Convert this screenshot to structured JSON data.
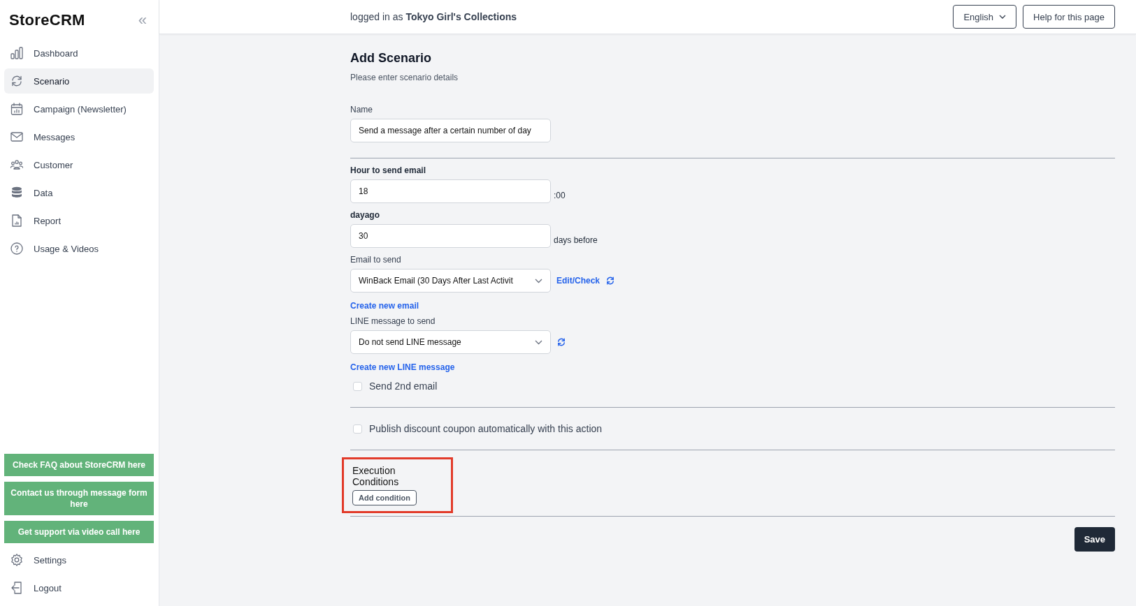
{
  "sidebar": {
    "logo": "StoreCRM",
    "collapse": "«",
    "items": [
      {
        "label": "Dashboard",
        "selected": false
      },
      {
        "label": "Scenario",
        "selected": true
      },
      {
        "label": "Campaign (Newsletter)",
        "selected": false
      },
      {
        "label": "Messages",
        "selected": false
      },
      {
        "label": "Customer",
        "selected": false
      },
      {
        "label": "Data",
        "selected": false
      },
      {
        "label": "Report",
        "selected": false
      },
      {
        "label": "Usage & Videos",
        "selected": false
      }
    ],
    "support_buttons": [
      "Check FAQ about StoreCRM here",
      "Contact us through message form here",
      "Get support via video call here"
    ],
    "bottom_items": [
      {
        "label": "Settings",
        "selected": false
      },
      {
        "label": "Logout",
        "selected": false
      }
    ]
  },
  "header": {
    "login_text": "logged in as **Tokyo Girl's Collections**",
    "language": "English",
    "help": "Help for this page"
  },
  "form": {
    "title": "Add Scenario",
    "subtitle": "Please enter scenario details",
    "name": {
      "label": "Name",
      "value": "Send a message after a certain number of day"
    },
    "hour": {
      "label": "Hour to send email",
      "value": "18",
      "suffix": ":00"
    },
    "dayago": {
      "label": "dayago",
      "value": "30",
      "suffix": "days before"
    },
    "email": {
      "label": "Email to send",
      "value": "WinBack Email (30 Days After Last Activit",
      "edit_link": "Edit/Check",
      "create_link": "Create new email"
    },
    "line": {
      "label": "LINE message to send",
      "value": "Do not send LINE message",
      "create_link": "Create new LINE message"
    },
    "second_email": {
      "label": "Send 2nd email",
      "checked": false
    },
    "coupon": {
      "label": "Publish discount coupon automatically with this action",
      "checked": false
    },
    "execution_conditions": {
      "title": "Execution Conditions",
      "button": "Add condition",
      "highlighted": true
    },
    "save": "Save"
  }
}
